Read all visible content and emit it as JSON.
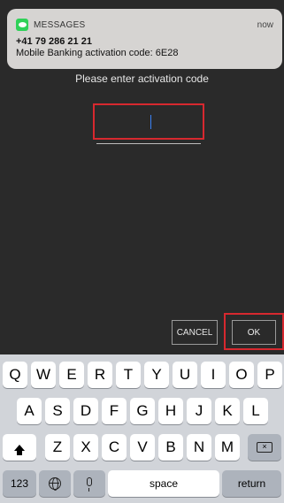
{
  "notification": {
    "app_name": "MESSAGES",
    "time": "now",
    "sender": "+41 79 286 21 21",
    "body": "Mobile Banking activation code: 6E28"
  },
  "dialog": {
    "prompt": "Please enter activation code",
    "code_value": "",
    "cancel_label": "CANCEL",
    "ok_label": "OK"
  },
  "keyboard": {
    "row1": [
      "Q",
      "W",
      "E",
      "R",
      "T",
      "Y",
      "U",
      "I",
      "O",
      "P"
    ],
    "row2": [
      "A",
      "S",
      "D",
      "F",
      "G",
      "H",
      "J",
      "K",
      "L"
    ],
    "row3": [
      "Z",
      "X",
      "C",
      "V",
      "B",
      "N",
      "M"
    ],
    "numbers_label": "123",
    "space_label": "space",
    "return_label": "return",
    "icons": {
      "shift": "shift-icon",
      "globe": "globe-icon",
      "mic": "microphone-icon",
      "delete": "backspace-icon"
    }
  },
  "colors": {
    "highlight": "#d7282f",
    "background": "#2a2a2a",
    "keyboard": "#d1d4d9"
  }
}
